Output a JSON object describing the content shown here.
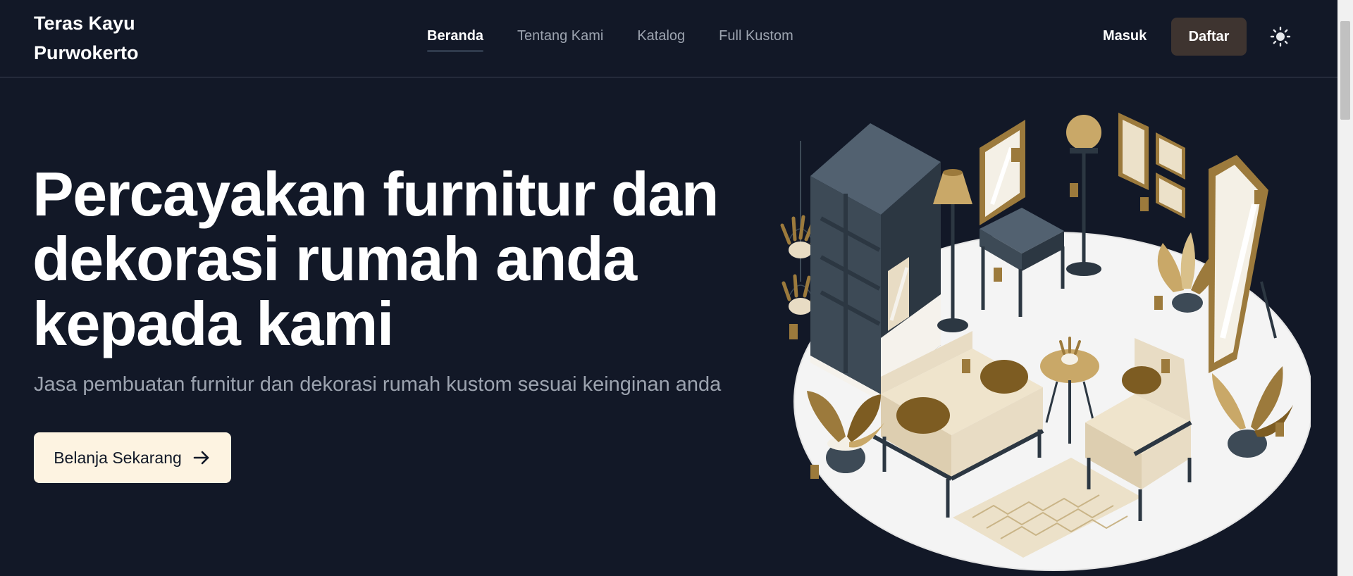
{
  "brand": {
    "line1": "Teras Kayu",
    "line2": "Purwokerto"
  },
  "nav": {
    "items": [
      {
        "label": "Beranda",
        "active": true
      },
      {
        "label": "Tentang Kami",
        "active": false
      },
      {
        "label": "Katalog",
        "active": false
      },
      {
        "label": "Full Kustom",
        "active": false
      }
    ]
  },
  "auth": {
    "login_label": "Masuk",
    "register_label": "Daftar"
  },
  "theme_toggle": {
    "icon": "sun-icon"
  },
  "hero": {
    "title_line1": "Percayakan furnitur dan",
    "title_line2": "dekorasi rumah anda",
    "title_line3": "kepada kami",
    "subtitle": "Jasa pembuatan furnitur dan dekorasi rumah kustom sesuai keinginan anda",
    "cta_label": "Belanja Sekarang",
    "cta_icon": "arrow-right-icon"
  },
  "colors": {
    "background": "#121827",
    "muted_text": "#9ca3af",
    "register_button": "#3e3430",
    "cta_button": "#fdf3e1",
    "furniture_dark": "#3d4a56",
    "furniture_gold": "#9c7a3c",
    "furniture_beige": "#e8dcc4"
  }
}
